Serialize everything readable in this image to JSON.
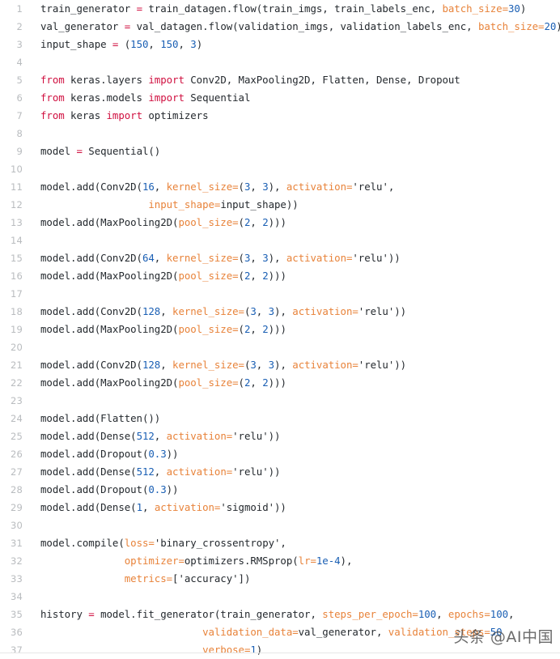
{
  "document": {
    "kind": "code-snippet",
    "language": "python",
    "background_color": "#ffffff",
    "gutter_color": "#b9bcbf",
    "text_color": "#24292e"
  },
  "syntax_colors": {
    "keyword": "#d01040",
    "operator": "#d01040",
    "number": "#1a5fb4",
    "keyword_argument": "#e8833a",
    "plain": "#24292e"
  },
  "watermark": {
    "text": "头条 @AI中国"
  },
  "code": {
    "lines": [
      {
        "number": "1",
        "tokens": [
          {
            "t": "train_generator ",
            "c": "t-pl"
          },
          {
            "t": "=",
            "c": "t-op"
          },
          {
            "t": " train_datagen.flow(train_imgs, train_labels_enc, ",
            "c": "t-pl"
          },
          {
            "t": "batch_size=",
            "c": "t-kwa"
          },
          {
            "t": "30",
            "c": "t-num"
          },
          {
            "t": ")",
            "c": "t-pl"
          }
        ]
      },
      {
        "number": "2",
        "tokens": [
          {
            "t": "val_generator ",
            "c": "t-pl"
          },
          {
            "t": "=",
            "c": "t-op"
          },
          {
            "t": " val_datagen.flow(validation_imgs, validation_labels_enc, ",
            "c": "t-pl"
          },
          {
            "t": "batch_size=",
            "c": "t-kwa"
          },
          {
            "t": "20",
            "c": "t-num"
          },
          {
            "t": ")",
            "c": "t-pl"
          }
        ]
      },
      {
        "number": "3",
        "tokens": [
          {
            "t": "input_shape ",
            "c": "t-pl"
          },
          {
            "t": "=",
            "c": "t-op"
          },
          {
            "t": " (",
            "c": "t-pl"
          },
          {
            "t": "150",
            "c": "t-num"
          },
          {
            "t": ", ",
            "c": "t-pl"
          },
          {
            "t": "150",
            "c": "t-num"
          },
          {
            "t": ", ",
            "c": "t-pl"
          },
          {
            "t": "3",
            "c": "t-num"
          },
          {
            "t": ")",
            "c": "t-pl"
          }
        ]
      },
      {
        "number": "4",
        "tokens": []
      },
      {
        "number": "5",
        "tokens": [
          {
            "t": "from",
            "c": "t-kw"
          },
          {
            "t": " keras.layers ",
            "c": "t-pl"
          },
          {
            "t": "import",
            "c": "t-kw"
          },
          {
            "t": " Conv2D, MaxPooling2D, Flatten, Dense, Dropout",
            "c": "t-pl"
          }
        ]
      },
      {
        "number": "6",
        "tokens": [
          {
            "t": "from",
            "c": "t-kw"
          },
          {
            "t": " keras.models ",
            "c": "t-pl"
          },
          {
            "t": "import",
            "c": "t-kw"
          },
          {
            "t": " Sequential",
            "c": "t-pl"
          }
        ]
      },
      {
        "number": "7",
        "tokens": [
          {
            "t": "from",
            "c": "t-kw"
          },
          {
            "t": " keras ",
            "c": "t-pl"
          },
          {
            "t": "import",
            "c": "t-kw"
          },
          {
            "t": " optimizers",
            "c": "t-pl"
          }
        ]
      },
      {
        "number": "8",
        "tokens": []
      },
      {
        "number": "9",
        "tokens": [
          {
            "t": "model ",
            "c": "t-pl"
          },
          {
            "t": "=",
            "c": "t-op"
          },
          {
            "t": " Sequential()",
            "c": "t-pl"
          }
        ]
      },
      {
        "number": "10",
        "tokens": []
      },
      {
        "number": "11",
        "tokens": [
          {
            "t": "model.add(Conv2D(",
            "c": "t-pl"
          },
          {
            "t": "16",
            "c": "t-num"
          },
          {
            "t": ", ",
            "c": "t-pl"
          },
          {
            "t": "kernel_size=",
            "c": "t-kwa"
          },
          {
            "t": "(",
            "c": "t-pl"
          },
          {
            "t": "3",
            "c": "t-num"
          },
          {
            "t": ", ",
            "c": "t-pl"
          },
          {
            "t": "3",
            "c": "t-num"
          },
          {
            "t": "), ",
            "c": "t-pl"
          },
          {
            "t": "activation=",
            "c": "t-kwa"
          },
          {
            "t": "'relu',",
            "c": "t-pl"
          }
        ]
      },
      {
        "number": "12",
        "tokens": [
          {
            "t": "                  ",
            "c": "t-pl"
          },
          {
            "t": "input_shape=",
            "c": "t-kwa"
          },
          {
            "t": "input_shape))",
            "c": "t-pl"
          }
        ]
      },
      {
        "number": "13",
        "tokens": [
          {
            "t": "model.add(MaxPooling2D(",
            "c": "t-pl"
          },
          {
            "t": "pool_size=",
            "c": "t-kwa"
          },
          {
            "t": "(",
            "c": "t-pl"
          },
          {
            "t": "2",
            "c": "t-num"
          },
          {
            "t": ", ",
            "c": "t-pl"
          },
          {
            "t": "2",
            "c": "t-num"
          },
          {
            "t": ")))",
            "c": "t-pl"
          }
        ]
      },
      {
        "number": "14",
        "tokens": []
      },
      {
        "number": "15",
        "tokens": [
          {
            "t": "model.add(Conv2D(",
            "c": "t-pl"
          },
          {
            "t": "64",
            "c": "t-num"
          },
          {
            "t": ", ",
            "c": "t-pl"
          },
          {
            "t": "kernel_size=",
            "c": "t-kwa"
          },
          {
            "t": "(",
            "c": "t-pl"
          },
          {
            "t": "3",
            "c": "t-num"
          },
          {
            "t": ", ",
            "c": "t-pl"
          },
          {
            "t": "3",
            "c": "t-num"
          },
          {
            "t": "), ",
            "c": "t-pl"
          },
          {
            "t": "activation=",
            "c": "t-kwa"
          },
          {
            "t": "'relu'))",
            "c": "t-pl"
          }
        ]
      },
      {
        "number": "16",
        "tokens": [
          {
            "t": "model.add(MaxPooling2D(",
            "c": "t-pl"
          },
          {
            "t": "pool_size=",
            "c": "t-kwa"
          },
          {
            "t": "(",
            "c": "t-pl"
          },
          {
            "t": "2",
            "c": "t-num"
          },
          {
            "t": ", ",
            "c": "t-pl"
          },
          {
            "t": "2",
            "c": "t-num"
          },
          {
            "t": ")))",
            "c": "t-pl"
          }
        ]
      },
      {
        "number": "17",
        "tokens": []
      },
      {
        "number": "18",
        "tokens": [
          {
            "t": "model.add(Conv2D(",
            "c": "t-pl"
          },
          {
            "t": "128",
            "c": "t-num"
          },
          {
            "t": ", ",
            "c": "t-pl"
          },
          {
            "t": "kernel_size=",
            "c": "t-kwa"
          },
          {
            "t": "(",
            "c": "t-pl"
          },
          {
            "t": "3",
            "c": "t-num"
          },
          {
            "t": ", ",
            "c": "t-pl"
          },
          {
            "t": "3",
            "c": "t-num"
          },
          {
            "t": "), ",
            "c": "t-pl"
          },
          {
            "t": "activation=",
            "c": "t-kwa"
          },
          {
            "t": "'relu'))",
            "c": "t-pl"
          }
        ]
      },
      {
        "number": "19",
        "tokens": [
          {
            "t": "model.add(MaxPooling2D(",
            "c": "t-pl"
          },
          {
            "t": "pool_size=",
            "c": "t-kwa"
          },
          {
            "t": "(",
            "c": "t-pl"
          },
          {
            "t": "2",
            "c": "t-num"
          },
          {
            "t": ", ",
            "c": "t-pl"
          },
          {
            "t": "2",
            "c": "t-num"
          },
          {
            "t": ")))",
            "c": "t-pl"
          }
        ]
      },
      {
        "number": "20",
        "tokens": []
      },
      {
        "number": "21",
        "tokens": [
          {
            "t": "model.add(Conv2D(",
            "c": "t-pl"
          },
          {
            "t": "128",
            "c": "t-num"
          },
          {
            "t": ", ",
            "c": "t-pl"
          },
          {
            "t": "kernel_size=",
            "c": "t-kwa"
          },
          {
            "t": "(",
            "c": "t-pl"
          },
          {
            "t": "3",
            "c": "t-num"
          },
          {
            "t": ", ",
            "c": "t-pl"
          },
          {
            "t": "3",
            "c": "t-num"
          },
          {
            "t": "), ",
            "c": "t-pl"
          },
          {
            "t": "activation=",
            "c": "t-kwa"
          },
          {
            "t": "'relu'))",
            "c": "t-pl"
          }
        ]
      },
      {
        "number": "22",
        "tokens": [
          {
            "t": "model.add(MaxPooling2D(",
            "c": "t-pl"
          },
          {
            "t": "pool_size=",
            "c": "t-kwa"
          },
          {
            "t": "(",
            "c": "t-pl"
          },
          {
            "t": "2",
            "c": "t-num"
          },
          {
            "t": ", ",
            "c": "t-pl"
          },
          {
            "t": "2",
            "c": "t-num"
          },
          {
            "t": ")))",
            "c": "t-pl"
          }
        ]
      },
      {
        "number": "23",
        "tokens": []
      },
      {
        "number": "24",
        "tokens": [
          {
            "t": "model.add(Flatten())",
            "c": "t-pl"
          }
        ]
      },
      {
        "number": "25",
        "tokens": [
          {
            "t": "model.add(Dense(",
            "c": "t-pl"
          },
          {
            "t": "512",
            "c": "t-num"
          },
          {
            "t": ", ",
            "c": "t-pl"
          },
          {
            "t": "activation=",
            "c": "t-kwa"
          },
          {
            "t": "'relu'))",
            "c": "t-pl"
          }
        ]
      },
      {
        "number": "26",
        "tokens": [
          {
            "t": "model.add(Dropout(",
            "c": "t-pl"
          },
          {
            "t": "0.3",
            "c": "t-num"
          },
          {
            "t": "))",
            "c": "t-pl"
          }
        ]
      },
      {
        "number": "27",
        "tokens": [
          {
            "t": "model.add(Dense(",
            "c": "t-pl"
          },
          {
            "t": "512",
            "c": "t-num"
          },
          {
            "t": ", ",
            "c": "t-pl"
          },
          {
            "t": "activation=",
            "c": "t-kwa"
          },
          {
            "t": "'relu'))",
            "c": "t-pl"
          }
        ]
      },
      {
        "number": "28",
        "tokens": [
          {
            "t": "model.add(Dropout(",
            "c": "t-pl"
          },
          {
            "t": "0.3",
            "c": "t-num"
          },
          {
            "t": "))",
            "c": "t-pl"
          }
        ]
      },
      {
        "number": "29",
        "tokens": [
          {
            "t": "model.add(Dense(",
            "c": "t-pl"
          },
          {
            "t": "1",
            "c": "t-num"
          },
          {
            "t": ", ",
            "c": "t-pl"
          },
          {
            "t": "activation=",
            "c": "t-kwa"
          },
          {
            "t": "'sigmoid'))",
            "c": "t-pl"
          }
        ]
      },
      {
        "number": "30",
        "tokens": []
      },
      {
        "number": "31",
        "tokens": [
          {
            "t": "model.compile(",
            "c": "t-pl"
          },
          {
            "t": "loss=",
            "c": "t-kwa"
          },
          {
            "t": "'binary_crossentropy',",
            "c": "t-pl"
          }
        ]
      },
      {
        "number": "32",
        "tokens": [
          {
            "t": "              ",
            "c": "t-pl"
          },
          {
            "t": "optimizer=",
            "c": "t-kwa"
          },
          {
            "t": "optimizers.RMSprop(",
            "c": "t-pl"
          },
          {
            "t": "lr=",
            "c": "t-kwa"
          },
          {
            "t": "1e-4",
            "c": "t-num"
          },
          {
            "t": "),",
            "c": "t-pl"
          }
        ]
      },
      {
        "number": "33",
        "tokens": [
          {
            "t": "              ",
            "c": "t-pl"
          },
          {
            "t": "metrics=",
            "c": "t-kwa"
          },
          {
            "t": "['accuracy'])",
            "c": "t-pl"
          }
        ]
      },
      {
        "number": "34",
        "tokens": []
      },
      {
        "number": "35",
        "tokens": [
          {
            "t": "history ",
            "c": "t-pl"
          },
          {
            "t": "=",
            "c": "t-op"
          },
          {
            "t": " model.fit_generator(train_generator, ",
            "c": "t-pl"
          },
          {
            "t": "steps_per_epoch=",
            "c": "t-kwa"
          },
          {
            "t": "100",
            "c": "t-num"
          },
          {
            "t": ", ",
            "c": "t-pl"
          },
          {
            "t": "epochs=",
            "c": "t-kwa"
          },
          {
            "t": "100",
            "c": "t-num"
          },
          {
            "t": ",",
            "c": "t-pl"
          }
        ]
      },
      {
        "number": "36",
        "tokens": [
          {
            "t": "                           ",
            "c": "t-pl"
          },
          {
            "t": "validation_data=",
            "c": "t-kwa"
          },
          {
            "t": "val_generator, ",
            "c": "t-pl"
          },
          {
            "t": "validation_steps=",
            "c": "t-kwa"
          },
          {
            "t": "50",
            "c": "t-num"
          }
        ]
      },
      {
        "number": "37",
        "tokens": [
          {
            "t": "                           ",
            "c": "t-pl"
          },
          {
            "t": "verbose=",
            "c": "t-kwa"
          },
          {
            "t": "1",
            "c": "t-num"
          },
          {
            "t": ")",
            "c": "t-pl"
          }
        ]
      }
    ]
  }
}
